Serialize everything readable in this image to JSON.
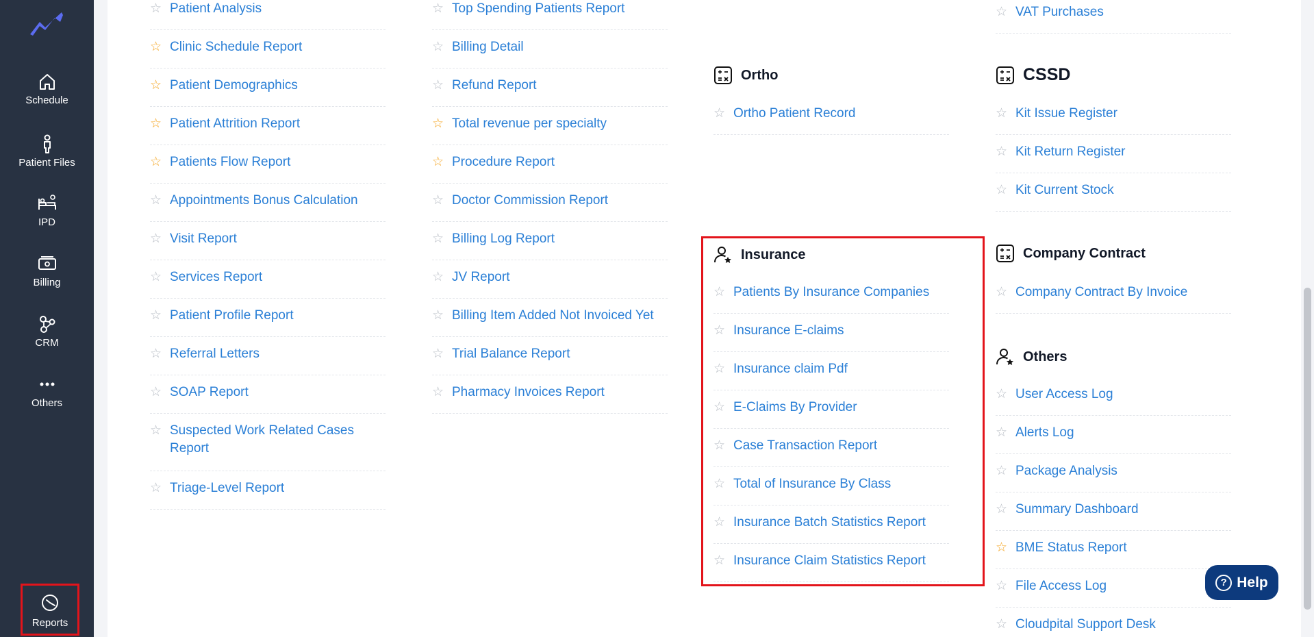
{
  "sidebar": {
    "items": [
      {
        "label": "Schedule",
        "icon": "home-icon"
      },
      {
        "label": "Patient Files",
        "icon": "person-icon"
      },
      {
        "label": "IPD",
        "icon": "bed-icon"
      },
      {
        "label": "Billing",
        "icon": "money-icon"
      },
      {
        "label": "CRM",
        "icon": "network-icon"
      },
      {
        "label": "Others",
        "icon": "dots-icon"
      }
    ],
    "reports_label": "Reports"
  },
  "col1": [
    {
      "label": "Patient Analysis",
      "fav": false
    },
    {
      "label": "Clinic Schedule Report",
      "fav": true
    },
    {
      "label": "Patient Demographics",
      "fav": true
    },
    {
      "label": "Patient Attrition Report",
      "fav": true
    },
    {
      "label": "Patients Flow Report",
      "fav": true
    },
    {
      "label": "Appointments Bonus Calculation",
      "fav": false
    },
    {
      "label": "Visit Report",
      "fav": false
    },
    {
      "label": "Services Report",
      "fav": false
    },
    {
      "label": "Patient Profile Report",
      "fav": false
    },
    {
      "label": "Referral Letters",
      "fav": false
    },
    {
      "label": "SOAP Report",
      "fav": false
    },
    {
      "label": "Suspected Work Related Cases Report",
      "fav": false
    },
    {
      "label": "Triage-Level Report",
      "fav": false
    }
  ],
  "col2": [
    {
      "label": "Top Spending Patients Report",
      "fav": false
    },
    {
      "label": "Billing Detail",
      "fav": false
    },
    {
      "label": "Refund Report",
      "fav": false
    },
    {
      "label": "Total revenue per specialty",
      "fav": true
    },
    {
      "label": "Procedure Report",
      "fav": true
    },
    {
      "label": "Doctor Commission Report",
      "fav": false
    },
    {
      "label": "Billing Log Report",
      "fav": false
    },
    {
      "label": "JV Report",
      "fav": false
    },
    {
      "label": "Billing Item Added Not Invoiced Yet",
      "fav": false
    },
    {
      "label": "Trial Balance Report",
      "fav": false
    },
    {
      "label": "Pharmacy Invoices Report",
      "fav": false
    }
  ],
  "ortho": {
    "title": "Ortho",
    "items": [
      {
        "label": "Ortho Patient Record",
        "fav": false
      }
    ]
  },
  "insurance": {
    "title": "Insurance",
    "items": [
      {
        "label": "Patients By Insurance Companies",
        "fav": false
      },
      {
        "label": "Insurance E-claims",
        "fav": false
      },
      {
        "label": "Insurance claim Pdf",
        "fav": false
      },
      {
        "label": "E-Claims By Provider",
        "fav": false
      },
      {
        "label": "Case Transaction Report",
        "fav": false
      },
      {
        "label": "Total of Insurance By Class",
        "fav": false
      },
      {
        "label": "Insurance Batch Statistics Report",
        "fav": false
      },
      {
        "label": "Insurance Claim Statistics Report",
        "fav": false
      }
    ]
  },
  "vat": {
    "items": [
      {
        "label": "VAT Purchases",
        "fav": false
      }
    ]
  },
  "cssd": {
    "title": "CSSD",
    "items": [
      {
        "label": "Kit Issue Register",
        "fav": false
      },
      {
        "label": "Kit Return Register",
        "fav": false
      },
      {
        "label": "Kit Current Stock",
        "fav": false
      }
    ]
  },
  "company_contract": {
    "title": "Company Contract",
    "items": [
      {
        "label": "Company Contract By Invoice",
        "fav": false
      }
    ]
  },
  "others": {
    "title": "Others",
    "items": [
      {
        "label": "User Access Log",
        "fav": false
      },
      {
        "label": "Alerts Log",
        "fav": false
      },
      {
        "label": "Package Analysis",
        "fav": false
      },
      {
        "label": "Summary Dashboard",
        "fav": false
      },
      {
        "label": "BME Status Report",
        "fav": true
      },
      {
        "label": "File Access Log",
        "fav": false
      },
      {
        "label": "Cloudpital Support Desk",
        "fav": false
      }
    ]
  },
  "help": {
    "label": "Help"
  },
  "colors": {
    "link": "#2a7fd6",
    "star_fav": "#f5a623",
    "star_off": "#b7bcc4",
    "sidebar": "#283242",
    "highlight": "#e3141b",
    "help_bg": "#0d3a7d"
  }
}
